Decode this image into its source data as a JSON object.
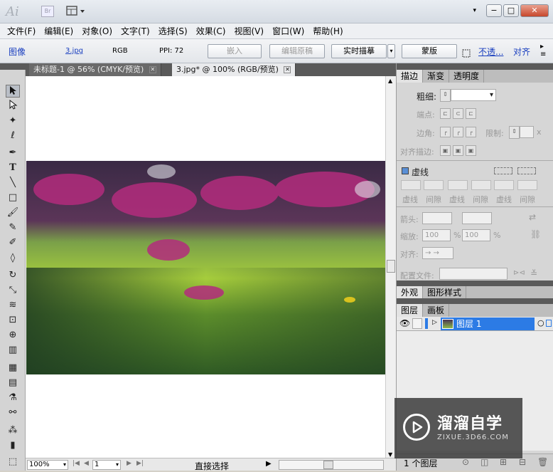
{
  "titlebar": {
    "app_logo": "Ai",
    "bridge": "Br",
    "dropdown": "▾",
    "minimize": "−",
    "restore": "□",
    "close": "✕"
  },
  "menu": [
    "文件(F)",
    "编辑(E)",
    "对象(O)",
    "文字(T)",
    "选择(S)",
    "效果(C)",
    "视图(V)",
    "窗口(W)",
    "帮助(H)"
  ],
  "controlbar": {
    "type_label": "图像",
    "file_link": "3.jpg",
    "color_mode": "RGB",
    "ppi": "PPI: 72",
    "embed": "嵌入",
    "edit_original": "编辑原稿",
    "live_trace": "实时描摹",
    "mask": "蒙版",
    "opacity_link": "不透...",
    "align_link": "对齐"
  },
  "tabs": [
    {
      "label": "未标题-1 @ 56% (CMYK/预览)"
    },
    {
      "label": "3.jpg* @ 100% (RGB/预览)"
    }
  ],
  "statusbar": {
    "zoom": "100%",
    "page": "1",
    "tool": "直接选择"
  },
  "stroke_panel": {
    "tabs": [
      "描边",
      "渐变",
      "透明度"
    ],
    "weight_label": "粗细:",
    "cap_label": "端点:",
    "corner_label": "边角:",
    "limit_label": "限制:",
    "limit_suffix": "x",
    "align_label": "对齐描边:",
    "dashed_label": "虚线",
    "dash_cols": [
      "虚线",
      "间隙",
      "虚线",
      "间隙",
      "虚线",
      "间隙"
    ],
    "arrow_label": "箭头:",
    "scale_label": "缩放:",
    "scale_val1": "100",
    "scale_val2": "100",
    "percent": "%",
    "align2_label": "对齐:",
    "profile_label": "配置文件:"
  },
  "appearance_panel": {
    "tabs": [
      "外观",
      "图形样式"
    ]
  },
  "layers_panel": {
    "tabs": [
      "图层",
      "画板"
    ],
    "layer_name": "图层 1",
    "footer_count": "1 个图层"
  },
  "watermark": {
    "title": "溜溜自学",
    "url": "ZIXUE.3D66.COM"
  },
  "colors": {
    "selection_blue": "#2c7be5",
    "header_dark": "#5a5a5a",
    "link_blue": "#1a3fbf"
  }
}
